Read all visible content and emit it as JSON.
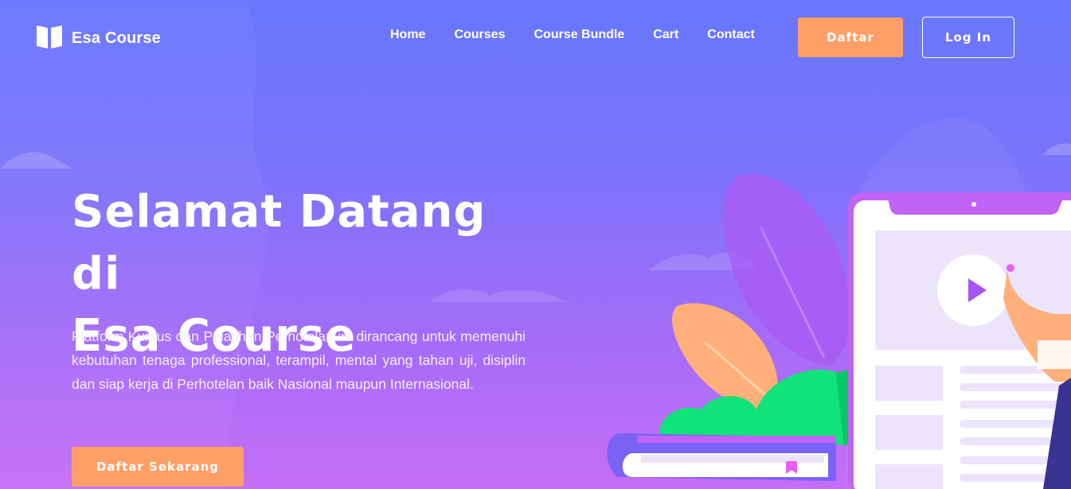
{
  "brand": {
    "name": "Esa Course",
    "icon": "open-book-icon"
  },
  "nav": {
    "links": [
      {
        "label": "Home"
      },
      {
        "label": "Courses"
      },
      {
        "label": "Course Bundle"
      },
      {
        "label": "Cart"
      },
      {
        "label": "Contact"
      }
    ],
    "register_label": "Daftar",
    "login_label": "Log In"
  },
  "hero": {
    "title_line1": "Selamat Datang di",
    "title_line2": "Esa Course",
    "description": "Platform Kursus dan Pelatihan Perhotelan ini dirancang untuk memenuhi kebutuhan tenaga professional, terampil, mental yang tahan uji, disiplin dan siap kerja di Perhotelan baik Nasional maupun Internasional.",
    "cta_label": "Daftar Sekarang"
  },
  "colors": {
    "accent": "#ff9f68",
    "gradient_top": "#6777fd",
    "gradient_bottom": "#c56ef7"
  }
}
